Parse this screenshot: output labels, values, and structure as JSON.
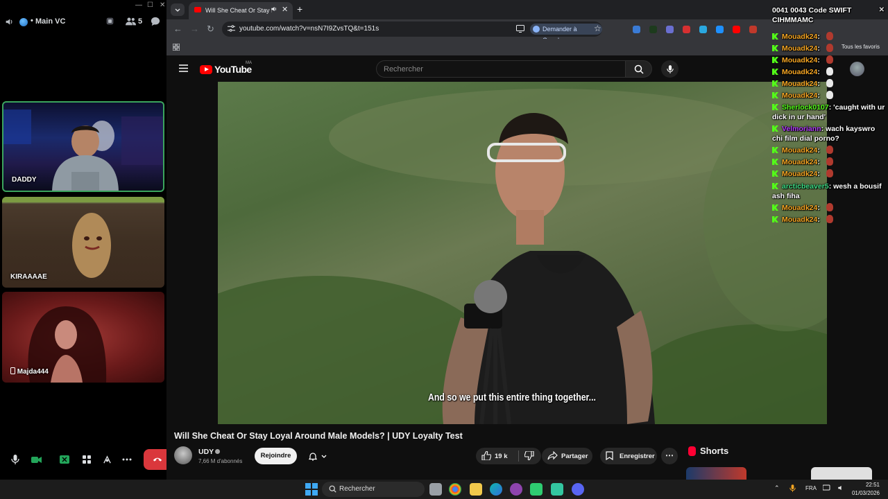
{
  "discord": {
    "channel_name": "Main VC",
    "member_count": "5",
    "participants": [
      {
        "name": "DADDY"
      },
      {
        "name": "KIRAAAAE"
      },
      {
        "name": "Majda444"
      }
    ]
  },
  "browser": {
    "tab_title": "Will She Cheat Or Stay Loyal Around Male Models? | UDY Loyalty Test",
    "url": "youtube.com/watch?v=nsN7I9ZvsTQ&t=151s",
    "ask_google": "Demander à Google",
    "all_favorites": "Tous les favoris"
  },
  "youtube": {
    "logo_text": "YouTube",
    "country_code": "MA",
    "search_placeholder": "Rechercher",
    "subtitle": "And so we put this entire thing together...",
    "video_title": "Will She Cheat Or Stay Loyal Around Male Models? | UDY Loyalty Test",
    "channel_name": "UDY",
    "subscribers": "7,66 M d'abonnés",
    "join_label": "Rejoindre",
    "like_count": "19 k",
    "share_label": "Partager",
    "save_label": "Enregistrer",
    "shorts_label": "Shorts"
  },
  "chat": {
    "header": "0041 0043 Code SWIFT CIHMMAMC",
    "messages": [
      {
        "user": "Mouadk24",
        "text": "",
        "color": "#f6a623"
      },
      {
        "user": "Mouadk24",
        "text": "",
        "color": "#f6a623"
      },
      {
        "user": "Mouadk24",
        "text": "",
        "color": "#f6a623"
      },
      {
        "user": "Mouadk24",
        "text": "",
        "color": "#f6a623"
      },
      {
        "user": "Mouadk24",
        "text": "",
        "color": "#f6a623"
      },
      {
        "user": "Mouadk24",
        "text": "",
        "color": "#f6a623"
      },
      {
        "user": "Sherlock0107",
        "text": "'caught with ur dick in ur hand'",
        "color": "#53fc18"
      },
      {
        "user": "Velmoriann",
        "text": "wach kayswro chi film dial porno?",
        "color": "#b23cfd"
      },
      {
        "user": "Mouadk24",
        "text": "",
        "color": "#f6a623"
      },
      {
        "user": "Mouadk24",
        "text": "",
        "color": "#f6a623"
      },
      {
        "user": "Mouadk24",
        "text": "",
        "color": "#f6a623"
      },
      {
        "user": "arcticbeaver5",
        "text": "wesh a bousif ash fiha",
        "color": "#3ddc84"
      },
      {
        "user": "Mouadk24",
        "text": "",
        "color": "#f6a623"
      },
      {
        "user": "Mouadk24",
        "text": "",
        "color": "#f6a623"
      }
    ]
  },
  "taskbar": {
    "search_label": "Rechercher",
    "language": "FRA",
    "time": "22:51",
    "date": "01/03/2026"
  }
}
